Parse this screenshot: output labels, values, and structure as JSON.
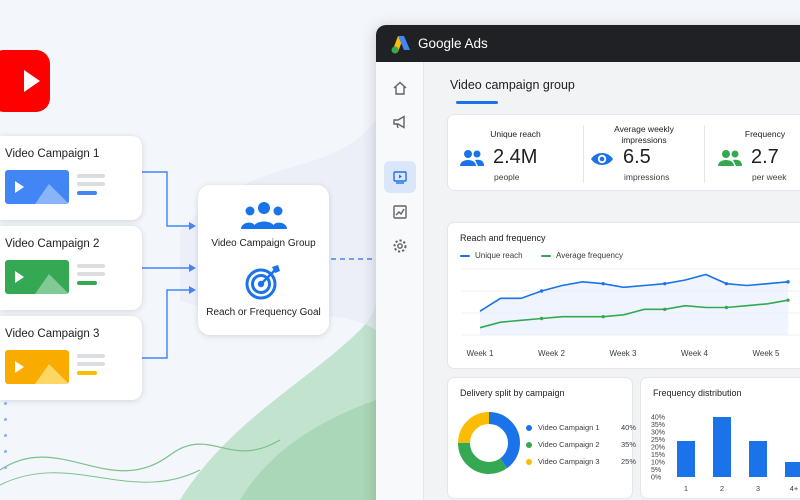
{
  "brand": "Google Ads",
  "campaigns": [
    {
      "label": "Video Campaign 1",
      "color": "#4285f4",
      "light": "#8ab4f8"
    },
    {
      "label": "Video Campaign 2",
      "color": "#34a853",
      "light": "#81c995"
    },
    {
      "label": "Video Campaign 3",
      "color": "#fbbc04",
      "light": "#fdd663"
    }
  ],
  "group": {
    "label": "Video Campaign Group",
    "goal_label": "Reach or Frequency Goal"
  },
  "page_title": "Video campaign group",
  "metrics": [
    {
      "label": "Unique reach",
      "value": "2.4M",
      "unit": "people",
      "icon": "people-icon"
    },
    {
      "label": "Average weekly impressions",
      "value": "6.5",
      "unit": "impressions",
      "icon": "eye-icon"
    },
    {
      "label": "Frequency",
      "value": "2.7",
      "unit": "per week",
      "icon": "people-icon"
    }
  ],
  "nav": [
    "home-icon",
    "megaphone-icon",
    "video-icon",
    "trending-chart-icon",
    "settings-icon"
  ],
  "reach_frequency": {
    "title": "Reach and frequency",
    "legend": [
      "Unique reach",
      "Average frequency"
    ]
  },
  "delivery_split": {
    "title": "Delivery split by campaign",
    "rows": [
      {
        "name": "Video Campaign 1",
        "pct": "40%",
        "color": "#1a73e8"
      },
      {
        "name": "Video Campaign 2",
        "pct": "35%",
        "color": "#34a853"
      },
      {
        "name": "Video Campaign 3",
        "pct": "25%",
        "color": "#fbbc04"
      }
    ]
  },
  "frequency_distribution": {
    "title": "Frequency distribution"
  },
  "chart_data": [
    {
      "type": "line",
      "title": "Reach and frequency",
      "x": [
        "Week 1",
        "Week 2",
        "Week 3",
        "Week 4",
        "Week 5"
      ],
      "series": [
        {
          "name": "Unique reach",
          "color": "#1a73e8",
          "values": [
            1.9,
            2.6,
            2.6,
            3.0,
            3.3,
            3.5,
            3.4,
            3.2,
            3.3,
            3.4,
            3.6,
            3.9,
            3.4,
            3.3,
            3.4,
            3.5
          ]
        },
        {
          "name": "Average frequency",
          "color": "#34a853",
          "values": [
            1.0,
            1.3,
            1.4,
            1.5,
            1.6,
            1.6,
            1.6,
            1.7,
            2.0,
            2.0,
            2.2,
            2.1,
            2.1,
            2.2,
            2.3,
            2.5
          ]
        }
      ],
      "grid": true,
      "legend_position": "top-left"
    },
    {
      "type": "pie",
      "title": "Delivery split by campaign",
      "categories": [
        "Video Campaign 1",
        "Video Campaign 2",
        "Video Campaign 3"
      ],
      "values": [
        40,
        35,
        25
      ],
      "colors": [
        "#1a73e8",
        "#34a853",
        "#fbbc04"
      ]
    },
    {
      "type": "bar",
      "title": "Frequency distribution",
      "categories": [
        "1",
        "2",
        "3",
        "4+"
      ],
      "values": [
        24,
        40,
        24,
        10
      ],
      "yticks": [
        "0%",
        "5%",
        "10%",
        "15%",
        "20%",
        "25%",
        "30%",
        "35%",
        "40%"
      ],
      "ylim": [
        0,
        40
      ],
      "color": "#1a73e8"
    }
  ]
}
